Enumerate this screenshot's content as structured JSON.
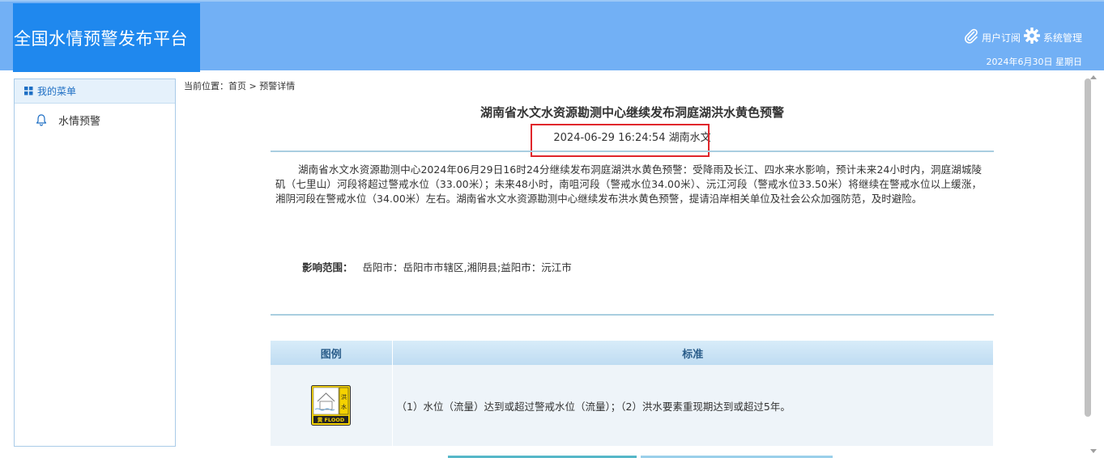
{
  "header": {
    "title": "全国水情预警发布平台",
    "subscribe_label": "用户订阅",
    "admin_label": "系统管理",
    "date": "2024年6月30日 星期日"
  },
  "sidebar": {
    "heading": "我的菜单",
    "items": [
      {
        "label": "水情预警",
        "icon": "bell-icon"
      }
    ]
  },
  "breadcrumb": {
    "prefix": "当前位置：",
    "home": "首页",
    "separator": " > ",
    "current": "预警详情"
  },
  "article": {
    "title": "湖南省水文水资源勘测中心继续发布洞庭湖洪水黄色预警",
    "meta": "2024-06-29 16:24:54 湖南水文",
    "body": "湖南省水文水资源勘测中心2024年06月29日16时24分继续发布洞庭湖洪水黄色预警：受降雨及长江、四水来水影响，预计未来24小时内，洞庭湖城陵矶（七里山）河段将超过警戒水位（33.00米）；未来48小时，南咀河段（警戒水位34.00米）、沅江河段（警戒水位33.50米）将继续在警戒水位以上缓涨，湘阴河段在警戒水位（34.00米）左右。湖南省水文水资源勘测中心继续发布洪水黄色预警，提请沿岸相关单位及社会公众加强防范，及时避险。",
    "scope_label": "影响范围：",
    "scope_value": "岳阳市：岳阳市市辖区,湘阴县;益阳市：沅江市"
  },
  "legend_table": {
    "headers": [
      "图例",
      "标准"
    ],
    "rows": [
      {
        "icon": "flood-yellow-warning-icon",
        "icon_text_top": "洪",
        "icon_text_bottom": "水",
        "icon_caption": "黄 FLOOD",
        "standard": "（1）水位（流量）达到或超过警戒水位（流量）；（2）洪水要素重现期达到或超过5年。"
      }
    ]
  },
  "colors": {
    "header_bg": "#72b0f5",
    "brand_bg": "#1f88ee",
    "highlight_border": "#e0262b",
    "warning_yellow": "#f5d200"
  }
}
